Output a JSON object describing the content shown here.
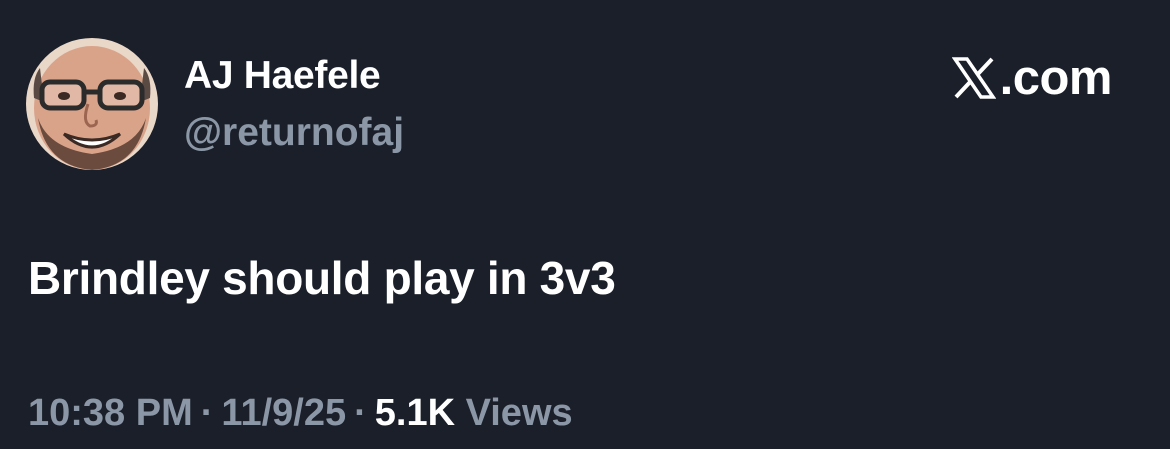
{
  "author": {
    "display_name": "AJ Haefele",
    "handle": "@returnofaj",
    "avatar_icon": "smiling-man-avatar-icon"
  },
  "site": {
    "logo_icon": "x-logo-icon",
    "label": ".com"
  },
  "post": {
    "text": "Brindley should play in 3v3"
  },
  "meta": {
    "time": "10:38 PM",
    "separator": "·",
    "date": "11/9/25",
    "views_count": "5.1K",
    "views_label": "Views"
  },
  "colors": {
    "background": "#1a1f29",
    "primary_text": "#ffffff",
    "secondary_text": "#8b97a6"
  }
}
